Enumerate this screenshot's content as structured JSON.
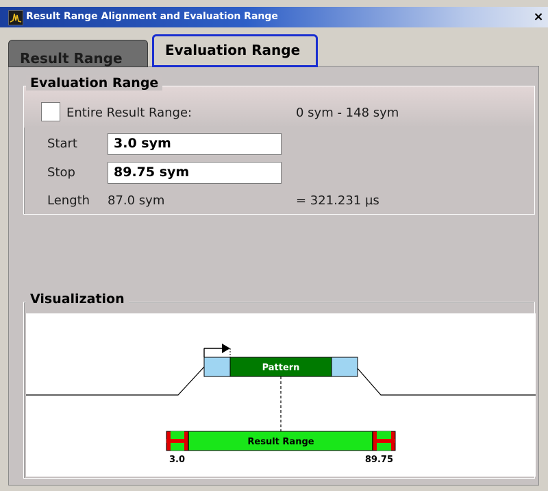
{
  "window": {
    "title": "Result Range Alignment and Evaluation Range",
    "close_glyph": "×"
  },
  "tabs": [
    {
      "label": "Result Range",
      "active": false
    },
    {
      "label": "Evaluation Range",
      "active": true
    }
  ],
  "evaluation_range": {
    "group_title": "Evaluation Range",
    "entire_checkbox_label": "Entire Result Range:",
    "entire_checked": false,
    "entire_range_value": "0 sym - 148 sym",
    "start_label": "Start",
    "start_value": "3.0 sym",
    "stop_label": "Stop",
    "stop_value": "89.75 sym",
    "length_label": "Length",
    "length_value": "87.0 sym",
    "length_time": "= 321.231 µs"
  },
  "visualization": {
    "group_title": "Visualization",
    "pattern_label": "Pattern",
    "result_range_label": "Result Range",
    "start_marker": "3.0",
    "stop_marker": "89.75"
  },
  "colors": {
    "pattern_fill": "#007a00",
    "result_range_fill": "#19e619",
    "pattern_edge_fill": "#9fd5f2",
    "marker_red": "#e00000",
    "active_tab_border": "#1a2fd0"
  },
  "icons": {
    "app": "spectrum-icon",
    "close": "close-icon",
    "shift_arrow": "right-arrow-icon"
  }
}
